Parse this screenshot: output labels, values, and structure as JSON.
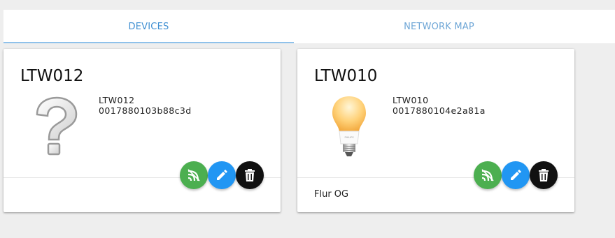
{
  "tabs": [
    {
      "label": "DEVICES"
    },
    {
      "label": "NETWORK MAP"
    }
  ],
  "devices": [
    {
      "title": "LTW012",
      "model": "LTW012",
      "id": "0017880103b88c3d",
      "room": "",
      "image": "question-mark-icon"
    },
    {
      "title": "LTW010",
      "model": "LTW010",
      "id": "0017880104e2a81a",
      "room": "Flur OG",
      "image": "light-bulb-icon"
    }
  ],
  "colors": {
    "accent": "#3f8fd2",
    "green": "#4caf50",
    "blue": "#2196f3",
    "black": "#111111"
  }
}
